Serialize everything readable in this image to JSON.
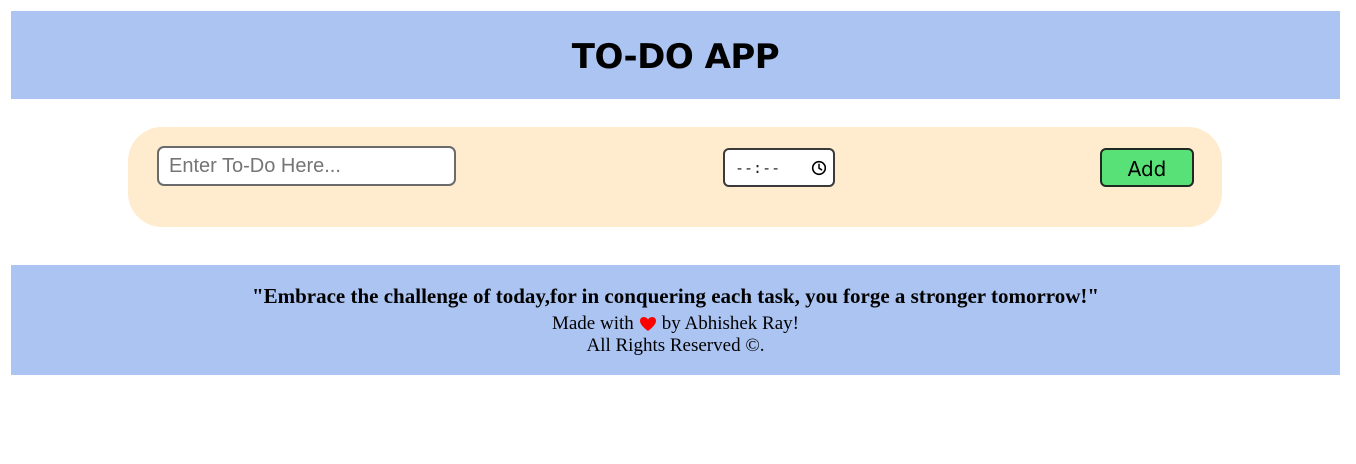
{
  "header": {
    "title": "TO-DO APP"
  },
  "form": {
    "todo_placeholder": "Enter To-Do Here...",
    "time_value": "--:--",
    "add_label": "Add"
  },
  "footer": {
    "quote": "\"Embrace the challenge of today,for in conquering each task, you forge a stronger tomorrow!\"",
    "made_prefix": "Made with",
    "made_suffix": "by Abhishek Ray!",
    "rights": "All Rights Reserved ©."
  },
  "colors": {
    "header_bg": "#abc4f2",
    "panel_bg": "#ffebcd",
    "add_button_bg": "#57e176",
    "heart": "#ff0000"
  },
  "icons": {
    "time": "clock-icon",
    "heart": "heart-icon"
  }
}
